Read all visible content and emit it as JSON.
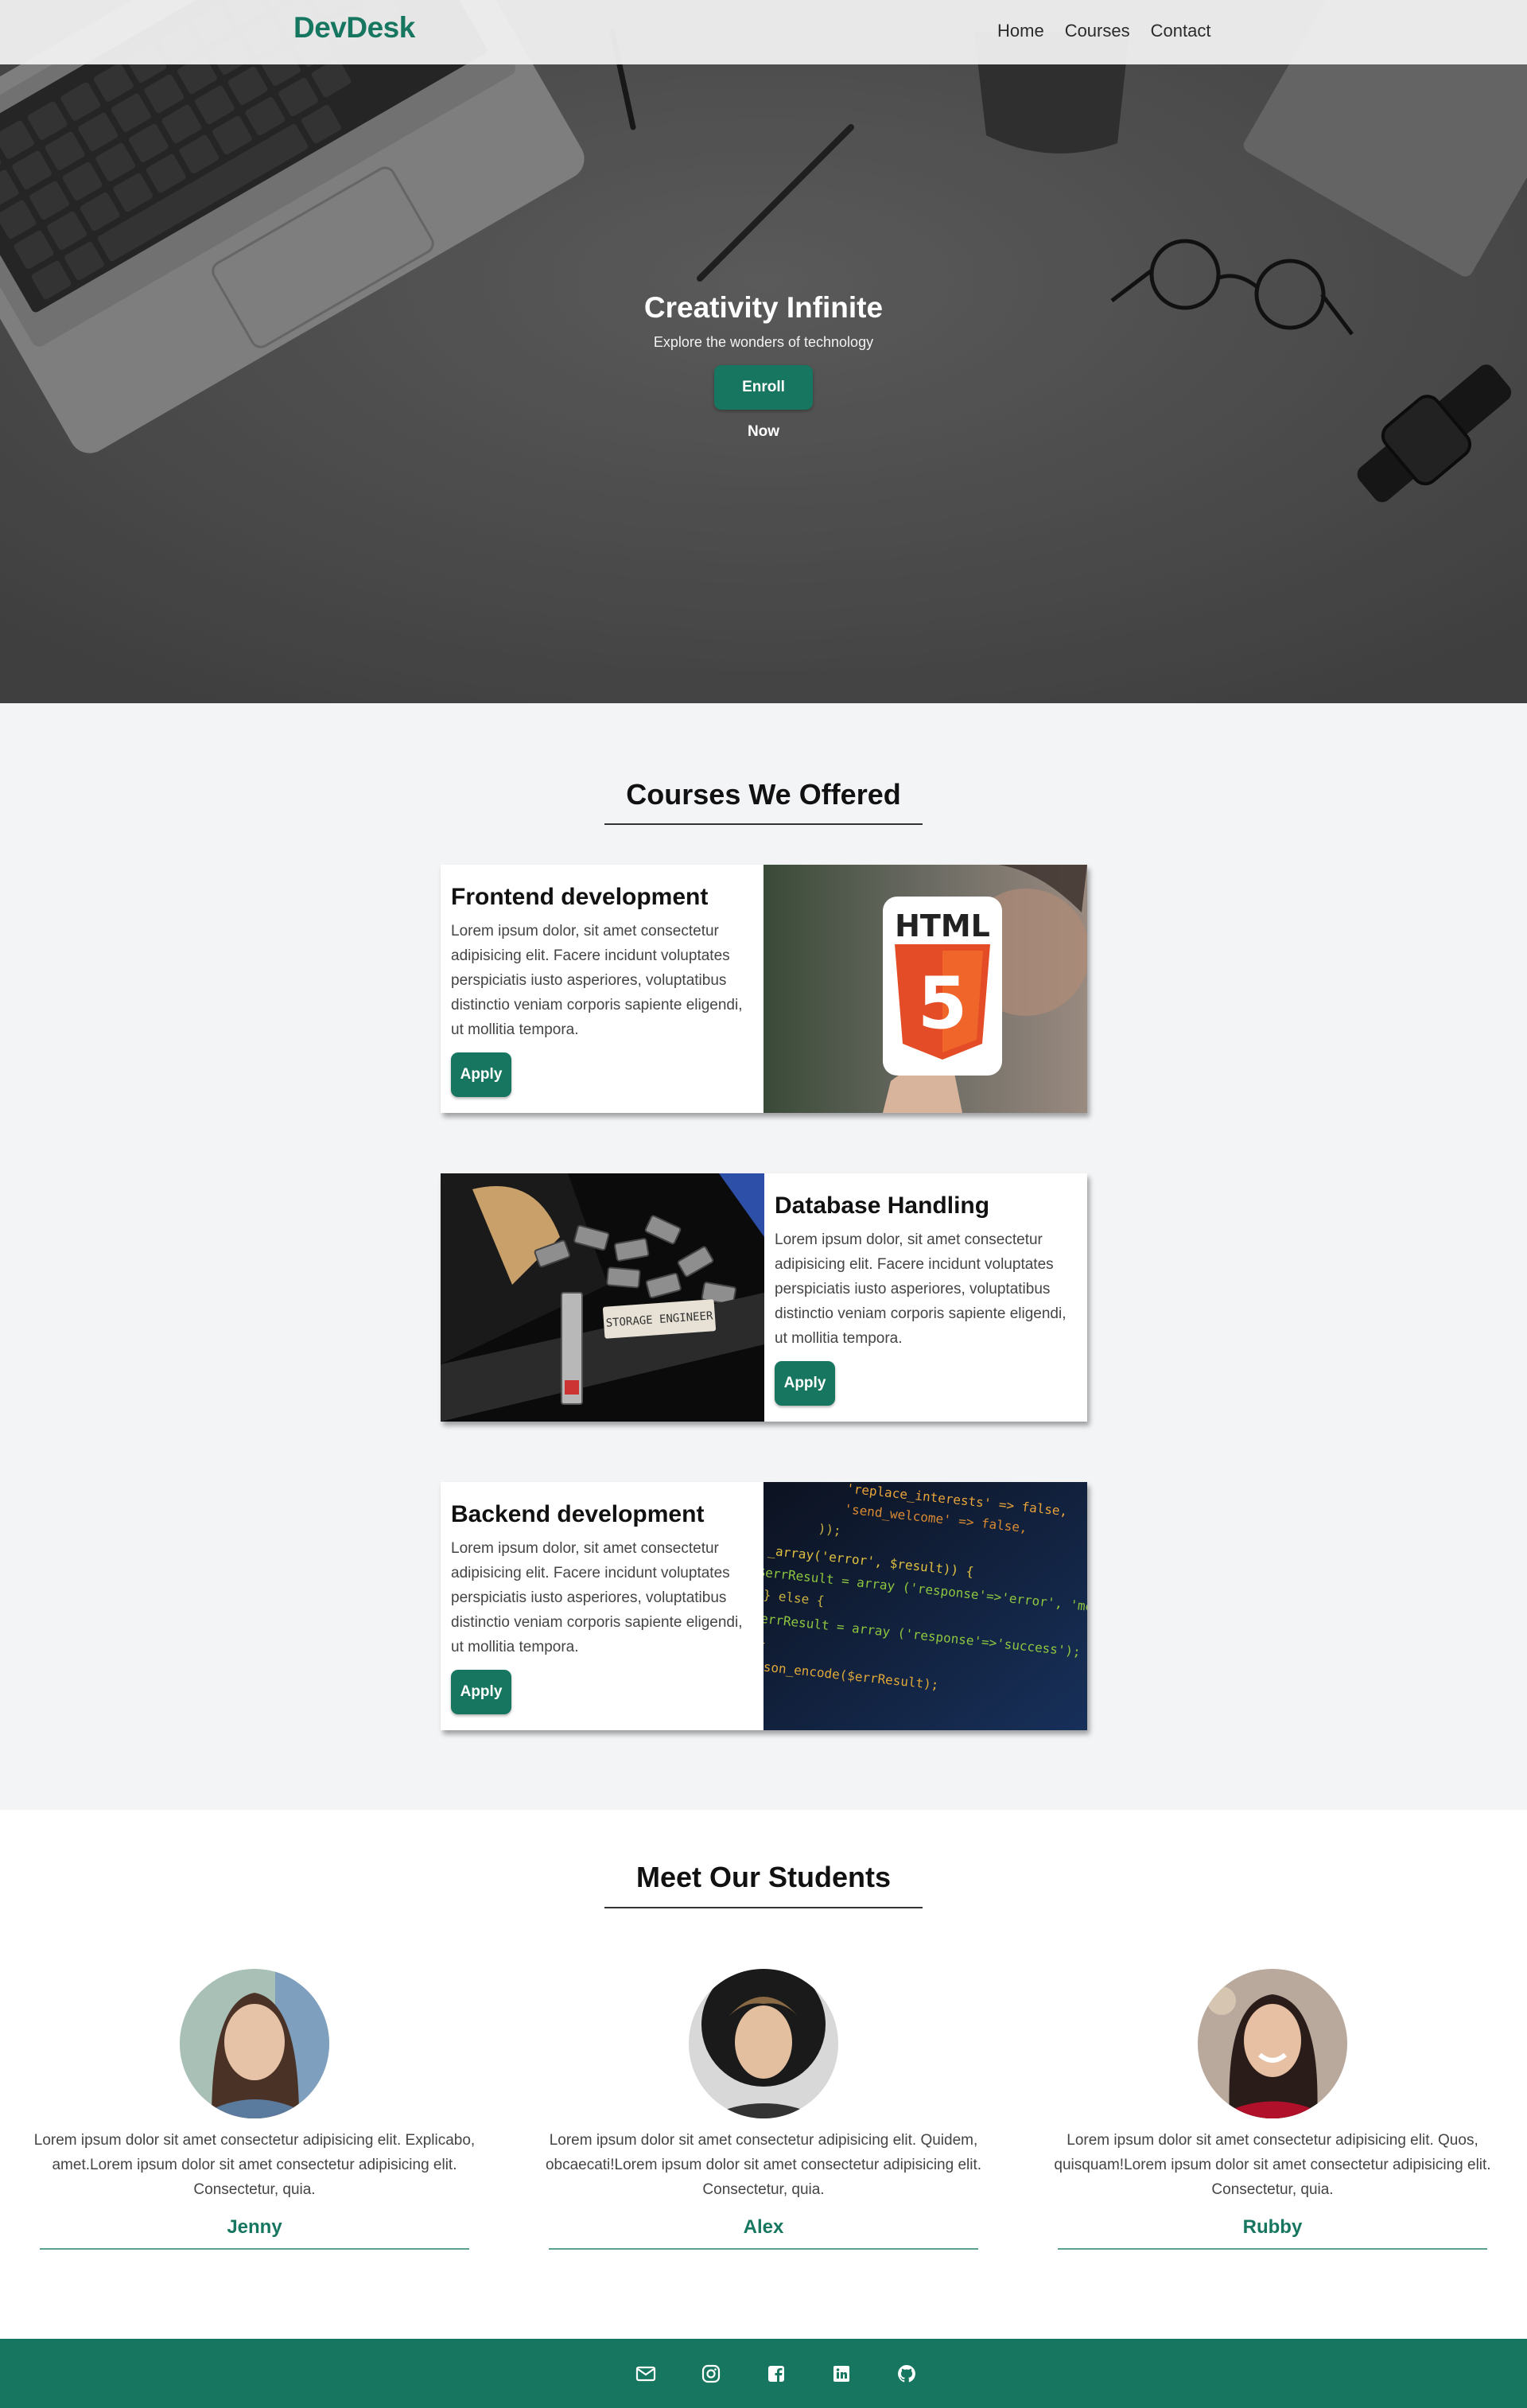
{
  "navbar": {
    "brand": "DevDesk",
    "links": [
      "Home",
      "Courses",
      "Contact"
    ]
  },
  "hero": {
    "title": "Creativity Infinite",
    "subtitle": "Explore the wonders of technology",
    "cta": "Enroll Now"
  },
  "courses": {
    "heading": "Courses We Offered",
    "items": [
      {
        "title": "Frontend development",
        "description": "Lorem ipsum dolor, sit amet consectetur adipisicing elit. Facere incidunt voluptates perspiciatis iusto asperiores, voluptatibus distinctio veniam corporis sapiente eligendi, ut mollitia tempora.",
        "button": "Apply",
        "image_text": "HTML",
        "image_badge": "5"
      },
      {
        "title": "Database Handling",
        "description": "Lorem ipsum dolor, sit amet consectetur adipisicing elit. Facere incidunt voluptates perspiciatis iusto asperiores, voluptatibus distinctio veniam corporis sapiente eligendi, ut mollitia tempora.",
        "button": "Apply",
        "image_text": "STORAGE ENGINEER"
      },
      {
        "title": "Backend development",
        "description": "Lorem ipsum dolor, sit amet consectetur adipisicing elit. Facere incidunt voluptates perspiciatis iusto asperiores, voluptatibus distinctio veniam corporis sapiente eligendi, ut mollitia tempora.",
        "button": "Apply",
        "code_lines": [
          "'replace_interests' => false,",
          "'send_welcome'      => false,",
          "));",
          "_array('error', $result)) {",
          "$errResult = array ('response'=>'error', 'message'",
          "} else {",
          "$errResult = array ('response'=>'success');",
          "}",
          "json_encode($errResult);"
        ]
      }
    ]
  },
  "students": {
    "heading": "Meet Our Students",
    "items": [
      {
        "name": "Jenny",
        "quote": "Lorem ipsum dolor sit amet consectetur adipisicing elit. Explicabo, amet.Lorem ipsum dolor sit amet consectetur adipisicing elit. Consectetur, quia."
      },
      {
        "name": "Alex",
        "quote": "Lorem ipsum dolor sit amet consectetur adipisicing elit. Quidem, obcaecati!Lorem ipsum dolor sit amet consectetur adipisicing elit. Consectetur, quia."
      },
      {
        "name": "Rubby",
        "quote": "Lorem ipsum dolor sit amet consectetur adipisicing elit. Quos, quisquam!Lorem ipsum dolor sit amet consectetur adipisicing elit. Consectetur, quia."
      }
    ]
  },
  "footer": {
    "icons": [
      "envelope-icon",
      "instagram-icon",
      "facebook-icon",
      "linkedin-icon",
      "github-icon"
    ]
  },
  "colors": {
    "brand": "#17765f",
    "hero_overlay": "#5b5b5b",
    "section_bg": "#f3f4f6"
  }
}
